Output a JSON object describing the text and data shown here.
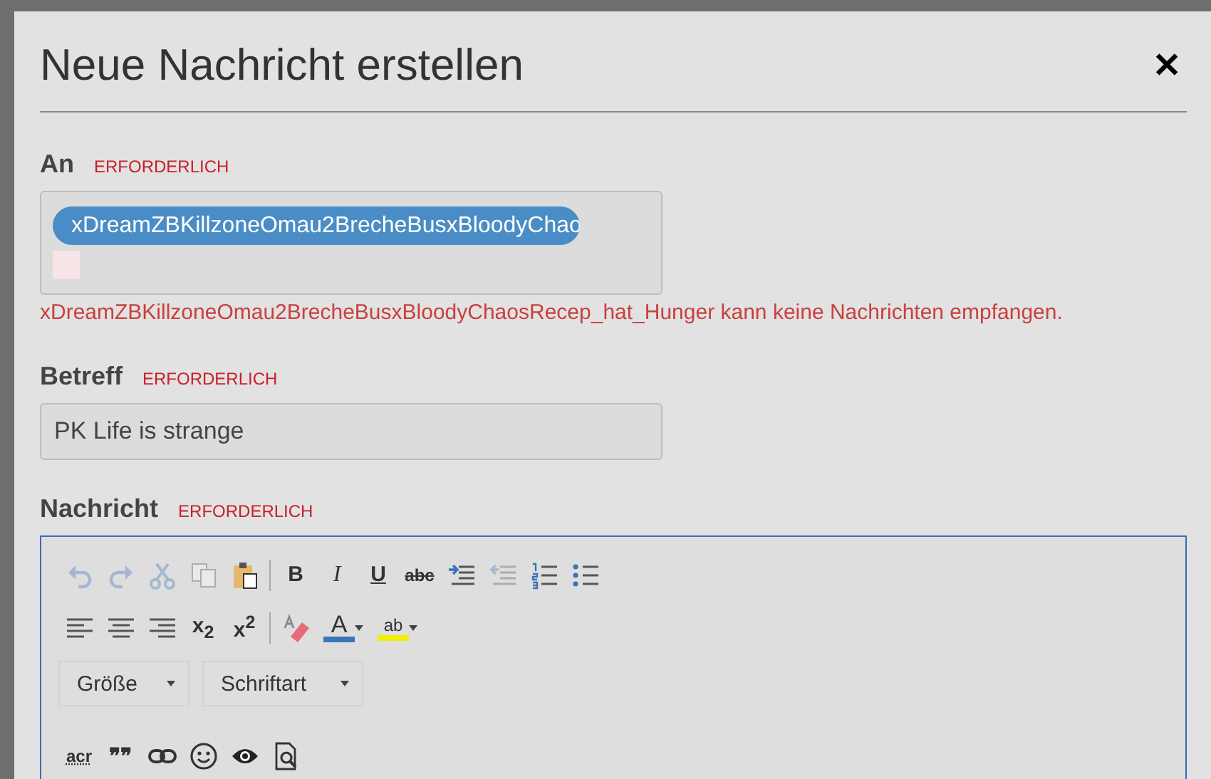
{
  "dialog": {
    "title": "Neue Nachricht erstellen",
    "close": "✕"
  },
  "recipient": {
    "label": "An",
    "required": "ERFORDERLICH",
    "chips": [
      "xDreamZBKillzoneOmau2BrecheBusxBloodyChao"
    ],
    "error": "xDreamZBKillzoneOmau2BrecheBusxBloodyChaosRecep_hat_Hunger kann keine Nachrichten empfangen."
  },
  "subject": {
    "label": "Betreff",
    "required": "ERFORDERLICH",
    "value": "PK Life is strange"
  },
  "message": {
    "label": "Nachricht",
    "required": "ERFORDERLICH",
    "toolbar_rows": [
      [
        {
          "kind": "undo",
          "disabled": true
        },
        {
          "kind": "redo",
          "disabled": true
        },
        {
          "kind": "cut",
          "disabled": true
        },
        {
          "kind": "copy",
          "disabled": true
        },
        {
          "kind": "paste",
          "disabled": false
        },
        {
          "kind": "separator"
        },
        {
          "kind": "bold",
          "label": "B",
          "disabled": false
        },
        {
          "kind": "italic",
          "label": "I",
          "disabled": false
        },
        {
          "kind": "underline",
          "label": "U",
          "disabled": false
        },
        {
          "kind": "strike",
          "label": "abc",
          "disabled": false
        },
        {
          "kind": "indent",
          "disabled": false
        },
        {
          "kind": "outdent",
          "disabled": true
        },
        {
          "kind": "numbered-list",
          "disabled": false
        },
        {
          "kind": "bulleted-list",
          "disabled": false
        }
      ],
      [
        {
          "kind": "align-left",
          "disabled": false
        },
        {
          "kind": "align-center",
          "disabled": false
        },
        {
          "kind": "align-right",
          "disabled": false
        },
        {
          "kind": "subscript",
          "label": "x$_{2}$",
          "disabled": false
        },
        {
          "kind": "superscript",
          "label": "x$^{2}$",
          "disabled": false
        },
        {
          "kind": "separator"
        },
        {
          "kind": "eraser",
          "disabled": false
        },
        {
          "kind": "text-color",
          "label": "A",
          "disabled": false
        },
        {
          "kind": "highlight",
          "label": "ab",
          "disabled": false
        }
      ]
    ],
    "combos": [
      {
        "label": "Größe"
      },
      {
        "label": "Schriftart"
      }
    ],
    "toolbar_bottom": [
      {
        "kind": "acronym",
        "label": "acr",
        "disabled": false
      },
      {
        "kind": "quote",
        "label": "❞❞",
        "disabled": false
      },
      {
        "kind": "link",
        "disabled": false
      },
      {
        "kind": "smiley",
        "disabled": false
      },
      {
        "kind": "eye",
        "disabled": false
      },
      {
        "kind": "preview",
        "disabled": false
      }
    ]
  }
}
